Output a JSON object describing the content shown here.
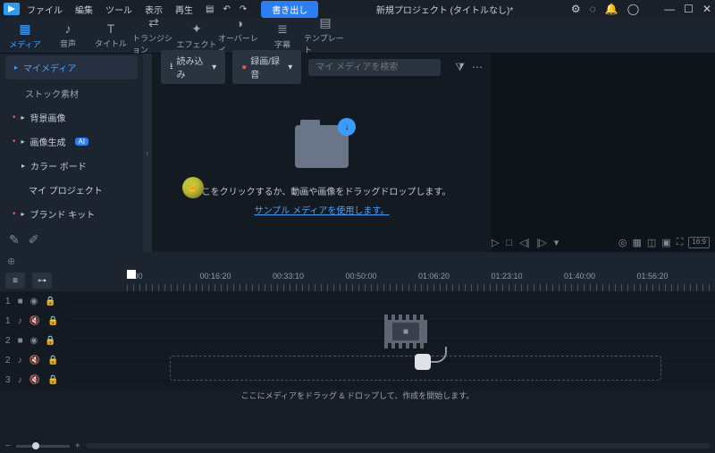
{
  "menubar": {
    "items": [
      "ファイル",
      "編集",
      "ツール",
      "表示",
      "再生"
    ],
    "export_label": "書き出し",
    "project_title": "新規プロジェクト (タイトルなし)*"
  },
  "tabs": [
    {
      "icon": "▦",
      "label": "メディア",
      "active": true
    },
    {
      "icon": "♪",
      "label": "音声"
    },
    {
      "icon": "T",
      "label": "タイトル"
    },
    {
      "icon": "⇄",
      "label": "トランジション"
    },
    {
      "icon": "✦",
      "label": "エフェクト"
    },
    {
      "icon": "◑",
      "label": "オーバーレイ"
    },
    {
      "icon": "≣",
      "label": "字幕"
    },
    {
      "icon": "▤",
      "label": "テンプレート"
    }
  ],
  "sidebar": {
    "items": [
      {
        "label": "マイメディア",
        "active": true,
        "chevron": "▸"
      },
      {
        "label": "ストック素材",
        "sub": true
      },
      {
        "label": "背景画像",
        "chevron": "▸",
        "bullet": true
      },
      {
        "label": "画像生成",
        "chevron": "▸",
        "badge": "AI",
        "bullet": true
      },
      {
        "label": "カラー ボード",
        "chevron": "▸"
      },
      {
        "label": "マイ プロジェクト"
      },
      {
        "label": "ブランド キット",
        "chevron": "▸",
        "bullet": true
      }
    ]
  },
  "media_toolbar": {
    "import_label": "読み込み",
    "record_label": "録画/録音",
    "search_placeholder": "マイ メディアを検索"
  },
  "drop_area": {
    "text": "ここをクリックするか、動画や画像をドラッグドロップします。",
    "link": "サンプル メディアを使用します。"
  },
  "preview": {
    "aspect": "16:9"
  },
  "ruler": {
    "labels": [
      "0:00",
      "00:16:20",
      "00:33:10",
      "00:50:00",
      "01:06:20",
      "01:23:10",
      "01:40:00",
      "01:56:20"
    ]
  },
  "tracks": [
    {
      "num": "1",
      "icon": "■"
    },
    {
      "num": "1",
      "icon": "♪"
    },
    {
      "num": "2",
      "icon": "■"
    },
    {
      "num": "2",
      "icon": "♪"
    },
    {
      "num": "3",
      "icon": "♪"
    }
  ],
  "timeline_drop": "ここにメディアをドラッグ & ドロップして、作成を開始します。"
}
